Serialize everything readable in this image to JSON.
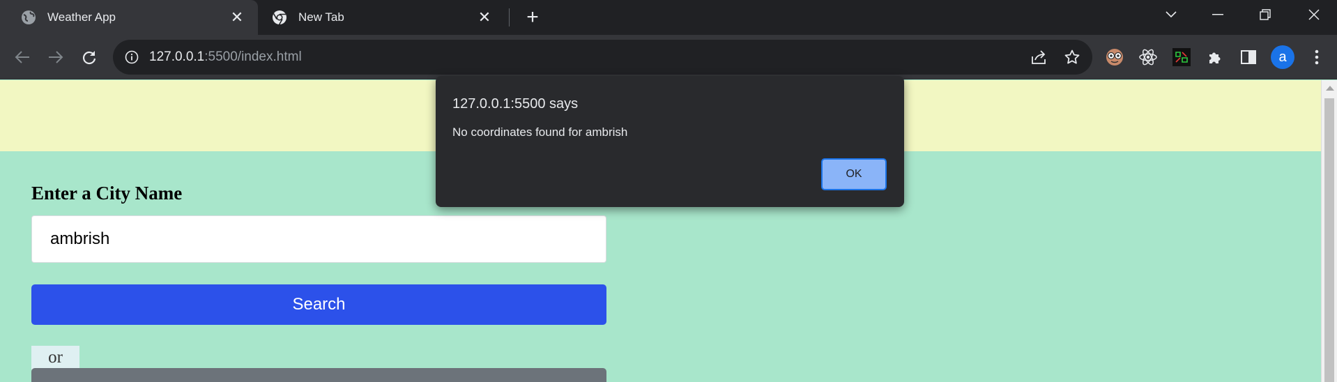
{
  "browser": {
    "tabs": [
      {
        "title": "Weather App",
        "favicon": "globe-icon",
        "active": true
      },
      {
        "title": "New Tab",
        "favicon": "chrome-icon",
        "active": false
      }
    ],
    "address": {
      "host": "127.0.0.1",
      "path": ":5500/index.html"
    },
    "profile_initial": "a"
  },
  "page": {
    "city_label": "Enter a City Name",
    "city_input_value": "ambrish",
    "search_label": "Search",
    "or_label": "or"
  },
  "alert": {
    "title": "127.0.0.1:5500 says",
    "message": "No coordinates found for ambrish",
    "ok_label": "OK"
  },
  "colors": {
    "page_background": "#a8e6cb",
    "header_band": "#f2f7c2",
    "search_button": "#2c51ea",
    "alert_background": "#292a2d",
    "alert_ok": "#8ab4f8"
  }
}
